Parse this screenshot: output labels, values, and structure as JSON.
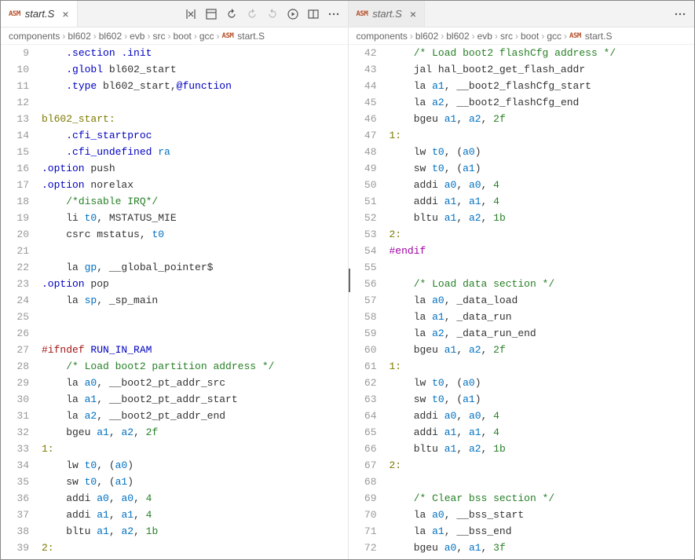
{
  "panes": [
    {
      "tab": {
        "badge": "ASM",
        "label": "start.S",
        "active": true,
        "closeable": true
      },
      "actions": [
        "compare",
        "diff",
        "revert-prev",
        "revert-next",
        "revert-last",
        "run",
        "split",
        "more"
      ],
      "breadcrumbs": [
        "components",
        "bl602",
        "bl602",
        "evb",
        "src",
        "boot",
        "gcc",
        "start.S"
      ],
      "startLine": 9,
      "lines": [
        [
          [
            "    ",
            ""
          ],
          [
            ".section",
            ".kw"
          ],
          [
            " ",
            ""
          ],
          [
            ".init",
            ".kw"
          ]
        ],
        [
          [
            "    ",
            ""
          ],
          [
            ".globl",
            ".kw"
          ],
          [
            " bl602_start",
            ""
          ]
        ],
        [
          [
            "    ",
            ""
          ],
          [
            ".type",
            ".kw"
          ],
          [
            " bl602_start,",
            ""
          ],
          [
            "@function",
            ".kw"
          ]
        ],
        [
          [
            "",
            ""
          ]
        ],
        [
          [
            "bl602_start:",
            ".lbl"
          ]
        ],
        [
          [
            "    ",
            ""
          ],
          [
            ".cfi_startproc",
            ".kw"
          ]
        ],
        [
          [
            "    ",
            ""
          ],
          [
            ".cfi_undefined",
            ".kw"
          ],
          [
            " ",
            ""
          ],
          [
            "ra",
            ".reg"
          ]
        ],
        [
          [
            ".option",
            ".kw"
          ],
          [
            " push",
            ""
          ]
        ],
        [
          [
            ".option",
            ".kw"
          ],
          [
            " norelax",
            ""
          ]
        ],
        [
          [
            "    ",
            ""
          ],
          [
            "/*disable IRQ*/",
            ".cm"
          ]
        ],
        [
          [
            "    li ",
            ""
          ],
          [
            "t0",
            ".reg"
          ],
          [
            ", MSTATUS_MIE",
            ""
          ]
        ],
        [
          [
            "    csrc mstatus, ",
            ""
          ],
          [
            "t0",
            ".reg"
          ]
        ],
        [
          [
            "",
            ""
          ]
        ],
        [
          [
            "    la ",
            ""
          ],
          [
            "gp",
            ".reg"
          ],
          [
            ", __global_pointer$",
            ""
          ]
        ],
        [
          [
            ".option",
            ".kw"
          ],
          [
            " pop",
            ""
          ]
        ],
        [
          [
            "    la ",
            ""
          ],
          [
            "sp",
            ".reg"
          ],
          [
            ", _sp_main",
            ""
          ]
        ],
        [
          [
            "",
            ""
          ]
        ],
        [
          [
            "",
            ""
          ]
        ],
        [
          [
            "#ifndef",
            ".pp"
          ],
          [
            " ",
            ""
          ],
          [
            "RUN_IN_RAM",
            ".mac"
          ]
        ],
        [
          [
            "    ",
            ""
          ],
          [
            "/* Load boot2 partition address */",
            ".cm"
          ]
        ],
        [
          [
            "    la ",
            ""
          ],
          [
            "a0",
            ".reg"
          ],
          [
            ", __boot2_pt_addr_src",
            ""
          ]
        ],
        [
          [
            "    la ",
            ""
          ],
          [
            "a1",
            ".reg"
          ],
          [
            ", __boot2_pt_addr_start",
            ""
          ]
        ],
        [
          [
            "    la ",
            ""
          ],
          [
            "a2",
            ".reg"
          ],
          [
            ", __boot2_pt_addr_end",
            ""
          ]
        ],
        [
          [
            "    bgeu ",
            ""
          ],
          [
            "a1",
            ".reg"
          ],
          [
            ", ",
            ""
          ],
          [
            "a2",
            ".reg"
          ],
          [
            ", ",
            ""
          ],
          [
            "2f",
            ".num"
          ]
        ],
        [
          [
            "1:",
            ".lbl"
          ]
        ],
        [
          [
            "    lw ",
            ""
          ],
          [
            "t0",
            ".reg"
          ],
          [
            ", (",
            ""
          ],
          [
            "a0",
            ".reg"
          ],
          [
            ")",
            ""
          ]
        ],
        [
          [
            "    sw ",
            ""
          ],
          [
            "t0",
            ".reg"
          ],
          [
            ", (",
            ""
          ],
          [
            "a1",
            ".reg"
          ],
          [
            ")",
            ""
          ]
        ],
        [
          [
            "    addi ",
            ""
          ],
          [
            "a0",
            ".reg"
          ],
          [
            ", ",
            ""
          ],
          [
            "a0",
            ".reg"
          ],
          [
            ", ",
            ""
          ],
          [
            "4",
            ".num"
          ]
        ],
        [
          [
            "    addi ",
            ""
          ],
          [
            "a1",
            ".reg"
          ],
          [
            ", ",
            ""
          ],
          [
            "a1",
            ".reg"
          ],
          [
            ", ",
            ""
          ],
          [
            "4",
            ".num"
          ]
        ],
        [
          [
            "    bltu ",
            ""
          ],
          [
            "a1",
            ".reg"
          ],
          [
            ", ",
            ""
          ],
          [
            "a2",
            ".reg"
          ],
          [
            ", ",
            ""
          ],
          [
            "1b",
            ".num"
          ]
        ],
        [
          [
            "2:",
            ".lbl"
          ]
        ]
      ]
    },
    {
      "tab": {
        "badge": "ASM",
        "label": "start.S",
        "active": false,
        "closeable": true
      },
      "actions": [
        "more"
      ],
      "breadcrumbs": [
        "components",
        "bl602",
        "bl602",
        "evb",
        "src",
        "boot",
        "gcc",
        "start.S"
      ],
      "startLine": 42,
      "lines": [
        [
          [
            "    ",
            ""
          ],
          [
            "/* Load boot2 flashCfg address */",
            ".cm"
          ]
        ],
        [
          [
            "    jal hal_boot2_get_flash_addr",
            ""
          ]
        ],
        [
          [
            "    la ",
            ""
          ],
          [
            "a1",
            ".reg"
          ],
          [
            ", __boot2_flashCfg_start",
            ""
          ]
        ],
        [
          [
            "    la ",
            ""
          ],
          [
            "a2",
            ".reg"
          ],
          [
            ", __boot2_flashCfg_end",
            ""
          ]
        ],
        [
          [
            "    bgeu ",
            ""
          ],
          [
            "a1",
            ".reg"
          ],
          [
            ", ",
            ""
          ],
          [
            "a2",
            ".reg"
          ],
          [
            ", ",
            ""
          ],
          [
            "2f",
            ".num"
          ]
        ],
        [
          [
            "1:",
            ".lbl"
          ]
        ],
        [
          [
            "    lw ",
            ""
          ],
          [
            "t0",
            ".reg"
          ],
          [
            ", (",
            ""
          ],
          [
            "a0",
            ".reg"
          ],
          [
            ")",
            ""
          ]
        ],
        [
          [
            "    sw ",
            ""
          ],
          [
            "t0",
            ".reg"
          ],
          [
            ", (",
            ""
          ],
          [
            "a1",
            ".reg"
          ],
          [
            ")",
            ""
          ]
        ],
        [
          [
            "    addi ",
            ""
          ],
          [
            "a0",
            ".reg"
          ],
          [
            ", ",
            ""
          ],
          [
            "a0",
            ".reg"
          ],
          [
            ", ",
            ""
          ],
          [
            "4",
            ".num"
          ]
        ],
        [
          [
            "    addi ",
            ""
          ],
          [
            "a1",
            ".reg"
          ],
          [
            ", ",
            ""
          ],
          [
            "a1",
            ".reg"
          ],
          [
            ", ",
            ""
          ],
          [
            "4",
            ".num"
          ]
        ],
        [
          [
            "    bltu ",
            ""
          ],
          [
            "a1",
            ".reg"
          ],
          [
            ", ",
            ""
          ],
          [
            "a2",
            ".reg"
          ],
          [
            ", ",
            ""
          ],
          [
            "1b",
            ".num"
          ]
        ],
        [
          [
            "2:",
            ".lbl"
          ]
        ],
        [
          [
            "#endif",
            ".ppend"
          ]
        ],
        [
          [
            "",
            ""
          ]
        ],
        [
          [
            "    ",
            ""
          ],
          [
            "/* Load data section */",
            ".cm"
          ]
        ],
        [
          [
            "    la ",
            ""
          ],
          [
            "a0",
            ".reg"
          ],
          [
            ", _data_load",
            ""
          ]
        ],
        [
          [
            "    la ",
            ""
          ],
          [
            "a1",
            ".reg"
          ],
          [
            ", _data_run",
            ""
          ]
        ],
        [
          [
            "    la ",
            ""
          ],
          [
            "a2",
            ".reg"
          ],
          [
            ", _data_run_end",
            ""
          ]
        ],
        [
          [
            "    bgeu ",
            ""
          ],
          [
            "a1",
            ".reg"
          ],
          [
            ", ",
            ""
          ],
          [
            "a2",
            ".reg"
          ],
          [
            ", ",
            ""
          ],
          [
            "2f",
            ".num"
          ]
        ],
        [
          [
            "1:",
            ".lbl"
          ]
        ],
        [
          [
            "    lw ",
            ""
          ],
          [
            "t0",
            ".reg"
          ],
          [
            ", (",
            ""
          ],
          [
            "a0",
            ".reg"
          ],
          [
            ")",
            ""
          ]
        ],
        [
          [
            "    sw ",
            ""
          ],
          [
            "t0",
            ".reg"
          ],
          [
            ", (",
            ""
          ],
          [
            "a1",
            ".reg"
          ],
          [
            ")",
            ""
          ]
        ],
        [
          [
            "    addi ",
            ""
          ],
          [
            "a0",
            ".reg"
          ],
          [
            ", ",
            ""
          ],
          [
            "a0",
            ".reg"
          ],
          [
            ", ",
            ""
          ],
          [
            "4",
            ".num"
          ]
        ],
        [
          [
            "    addi ",
            ""
          ],
          [
            "a1",
            ".reg"
          ],
          [
            ", ",
            ""
          ],
          [
            "a1",
            ".reg"
          ],
          [
            ", ",
            ""
          ],
          [
            "4",
            ".num"
          ]
        ],
        [
          [
            "    bltu ",
            ""
          ],
          [
            "a1",
            ".reg"
          ],
          [
            ", ",
            ""
          ],
          [
            "a2",
            ".reg"
          ],
          [
            ", ",
            ""
          ],
          [
            "1b",
            ".num"
          ]
        ],
        [
          [
            "2:",
            ".lbl"
          ]
        ],
        [
          [
            "",
            ""
          ]
        ],
        [
          [
            "    ",
            ""
          ],
          [
            "/* Clear bss section */",
            ".cm"
          ]
        ],
        [
          [
            "    la ",
            ""
          ],
          [
            "a0",
            ".reg"
          ],
          [
            ", __bss_start",
            ""
          ]
        ],
        [
          [
            "    la ",
            ""
          ],
          [
            "a1",
            ".reg"
          ],
          [
            ", __bss_end",
            ""
          ]
        ],
        [
          [
            "    bgeu ",
            ""
          ],
          [
            "a0",
            ".reg"
          ],
          [
            ", ",
            ""
          ],
          [
            "a1",
            ".reg"
          ],
          [
            ", ",
            ""
          ],
          [
            "3f",
            ".num"
          ]
        ]
      ]
    }
  ],
  "icons": {
    "compare": "compare-icon",
    "diff": "diff-icon",
    "revert-prev": "revert-prev-icon",
    "revert-next": "revert-next-icon",
    "revert-last": "revert-last-icon",
    "run": "run-icon",
    "split": "split-icon",
    "more": "more-icon"
  }
}
